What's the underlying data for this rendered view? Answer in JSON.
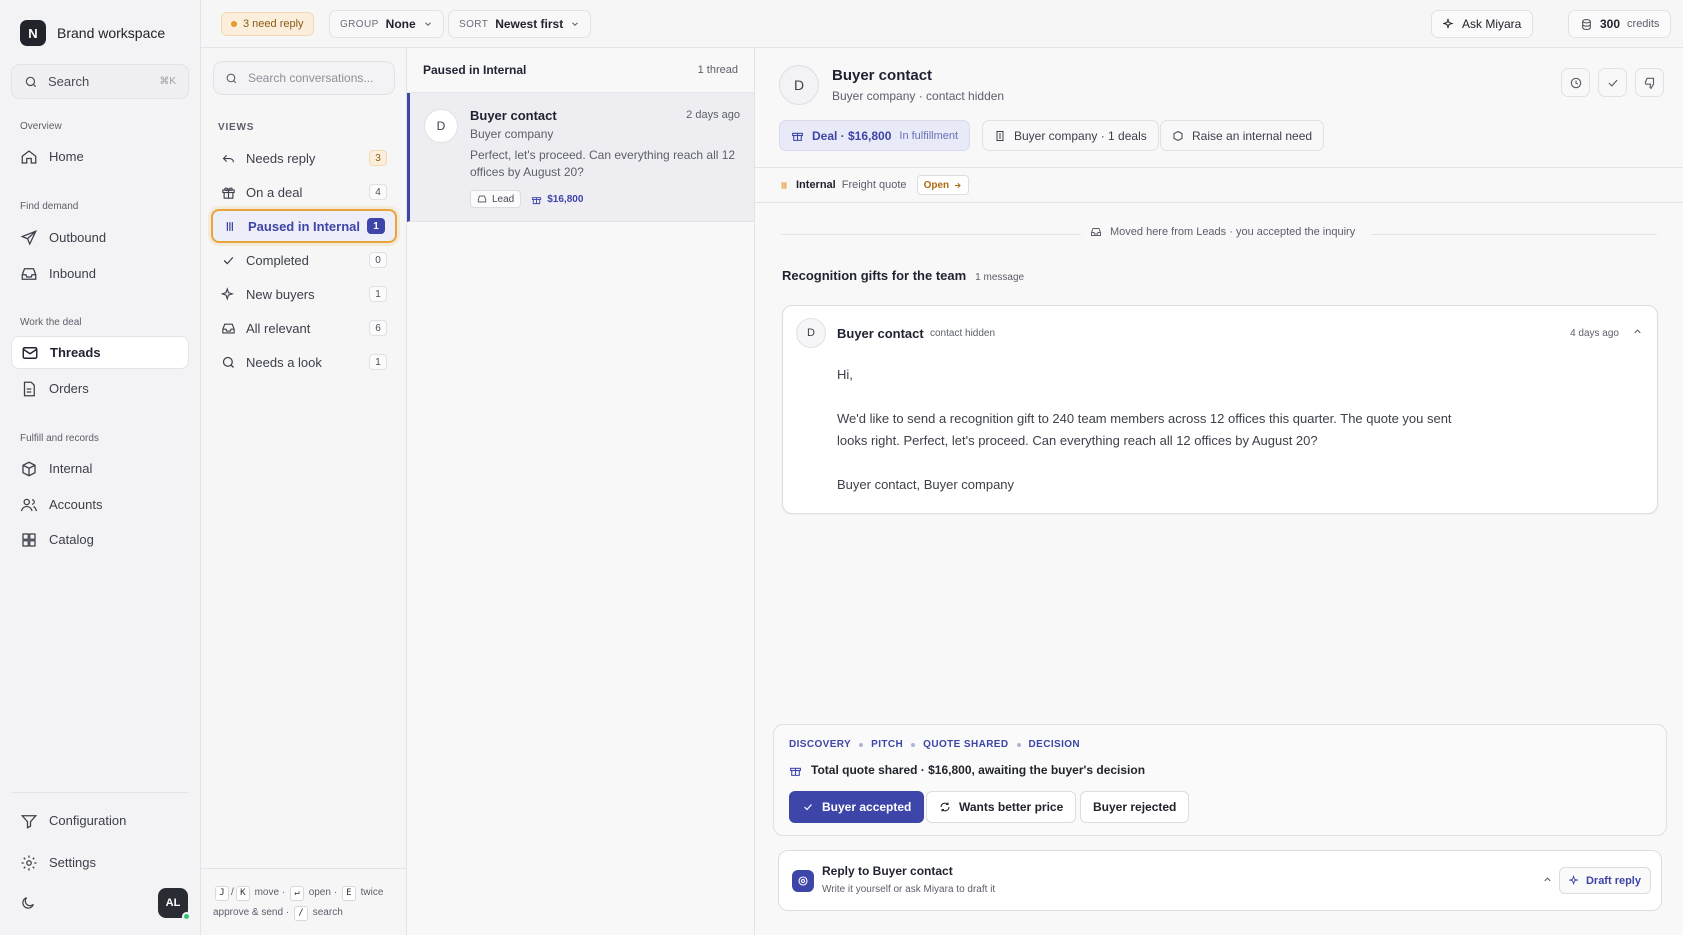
{
  "workspace": {
    "logo_letter": "N",
    "name": "Brand workspace"
  },
  "search": {
    "label": "Search",
    "shortcut": "⌘K"
  },
  "sidebar": {
    "sections": [
      {
        "label": "Overview"
      },
      {
        "label": "Find demand"
      },
      {
        "label": "Work the deal"
      },
      {
        "label": "Fulfill and records"
      }
    ],
    "items": [
      {
        "label": "Home",
        "icon": "home-icon"
      },
      {
        "label": "Outbound",
        "icon": "send-icon"
      },
      {
        "label": "Inbound",
        "icon": "inbox-icon"
      },
      {
        "label": "Threads",
        "icon": "mail-icon",
        "active": true
      },
      {
        "label": "Orders",
        "icon": "document-icon"
      },
      {
        "label": "Internal",
        "icon": "box-icon"
      },
      {
        "label": "Accounts",
        "icon": "users-icon"
      },
      {
        "label": "Catalog",
        "icon": "grid-icon"
      }
    ],
    "bottom": [
      {
        "label": "Configuration",
        "icon": "filter-icon"
      },
      {
        "label": "Settings",
        "icon": "gear-icon"
      }
    ],
    "avatar": "AL"
  },
  "topbar": {
    "need_reply": "3 need reply",
    "group_key": "GROUP",
    "group_value": "None",
    "sort_key": "SORT",
    "sort_value": "Newest first",
    "ask": "Ask Miyara",
    "credits_num": "300",
    "credits_label": "credits"
  },
  "views": {
    "search_placeholder": "Search conversations...",
    "heading": "VIEWS",
    "items": [
      {
        "label": "Needs reply",
        "count": "3"
      },
      {
        "label": "On a deal",
        "count": "4"
      },
      {
        "label": "Paused in Internal",
        "count": "1"
      },
      {
        "label": "Completed",
        "count": "0"
      },
      {
        "label": "New buyers",
        "count": "1"
      },
      {
        "label": "All relevant",
        "count": "6"
      },
      {
        "label": "Needs a look",
        "count": "1"
      }
    ],
    "footer": {
      "k1": "J",
      "slash1": "/",
      "k2": "K",
      "move": "move ·",
      "k3": "↵",
      "open": "open ·",
      "k4": "E",
      "twice": "twice",
      "approve": "approve & send ·",
      "k5": "/",
      "search": "search"
    }
  },
  "threads": {
    "title": "Paused in Internal",
    "count": "1 thread",
    "item": {
      "avatar": "D",
      "name": "Buyer contact",
      "time": "2 days ago",
      "company": "Buyer company",
      "preview": "Perfect, let's proceed. Can everything reach all 12 offices by August 20?",
      "tag": "Lead",
      "amount": "$16,800"
    }
  },
  "detail": {
    "avatar": "D",
    "name": "Buyer contact",
    "sub": "Buyer company · contact hidden",
    "chips": {
      "deal": "Deal · $16,800",
      "deal_sub": "In fulfillment",
      "company": "Buyer company · 1 deals",
      "raise": "Raise an internal need"
    },
    "strip": {
      "label": "Internal",
      "item": "Freight quote",
      "status": "Open"
    },
    "moved": "Moved here from Leads · you accepted the inquiry",
    "subject": "Recognition gifts for the team",
    "subject_count": "1 message",
    "message": {
      "avatar": "D",
      "from": "Buyer contact",
      "hidden": "contact hidden",
      "time": "4 days ago",
      "greeting": "Hi,",
      "body": "We'd like to send a recognition gift to 240 team members across 12 offices this quarter. The quote you sent looks right. Perfect, let's proceed. Can everything reach all 12 offices by August 20?",
      "signoff": "Buyer contact, Buyer company"
    },
    "stage": {
      "steps": [
        "DISCOVERY",
        "PITCH",
        "QUOTE SHARED",
        "DECISION"
      ],
      "summary": "Total quote shared · $16,800, awaiting the buyer's decision",
      "accepted": "Buyer accepted",
      "better": "Wants better price",
      "rejected": "Buyer rejected"
    },
    "reply": {
      "title": "Reply to Buyer contact",
      "sub": "Write it yourself or ask Miyara to draft it",
      "draft": "Draft reply"
    }
  },
  "colors": {
    "accent": "#3d45a8",
    "warning": "#e8a53c",
    "online": "#34c27a"
  }
}
